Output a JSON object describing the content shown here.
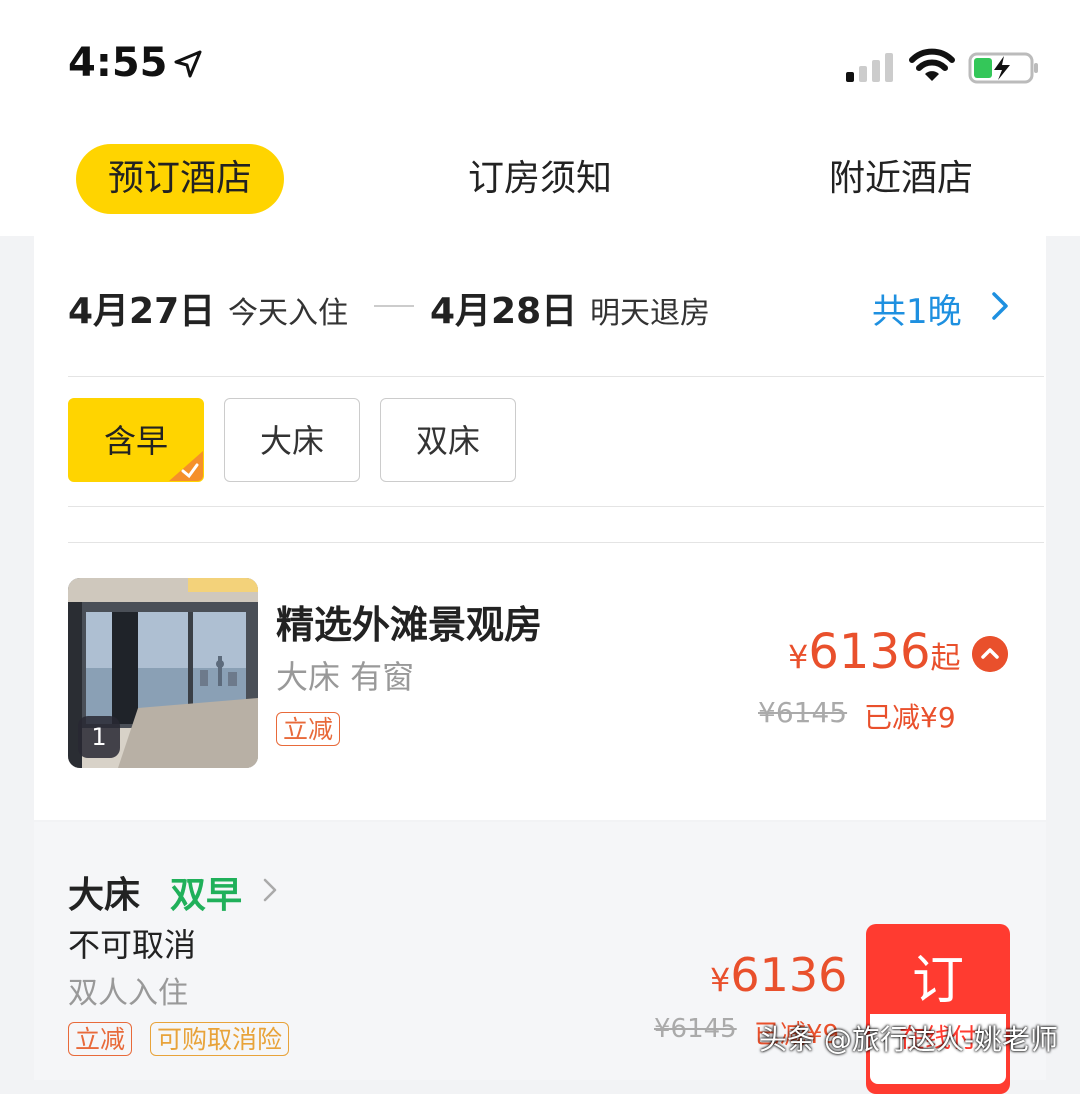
{
  "status_bar": {
    "time": "4:55"
  },
  "tabs": [
    {
      "label": "预订酒店",
      "active": true
    },
    {
      "label": "订房须知",
      "active": false
    },
    {
      "label": "附近酒店",
      "active": false
    }
  ],
  "dates": {
    "checkin": "4月27日",
    "checkin_label": "今天入住",
    "checkout": "4月28日",
    "checkout_label": "明天退房",
    "nights": "共1晚"
  },
  "filters": [
    {
      "label": "含早",
      "selected": true
    },
    {
      "label": "大床",
      "selected": false
    },
    {
      "label": "双床",
      "selected": false
    }
  ],
  "room": {
    "photo_count": "1",
    "name": "精选外滩景观房",
    "desc": "大床 有窗",
    "tag": "立减",
    "currency": "¥",
    "price": "6136",
    "price_suffix": "起",
    "orig_price": "¥6145",
    "discount": "已减¥9"
  },
  "plan": {
    "bed": "大床",
    "breakfast": "双早",
    "cancel": "不可取消",
    "occupancy": "双人入住",
    "tag1": "立减",
    "tag2": "可购取消险",
    "currency": "¥",
    "price": "6136",
    "orig_price": "¥6145",
    "discount": "已减¥9",
    "book_label": "订",
    "book_sub": "在线付"
  },
  "watermark": "头条 @旅行达人-姚老师",
  "colors": {
    "accent": "#ffd400",
    "price": "#e9502c",
    "link": "#1e90e0",
    "breakfast": "#20b05a",
    "book": "#ff3b30"
  }
}
